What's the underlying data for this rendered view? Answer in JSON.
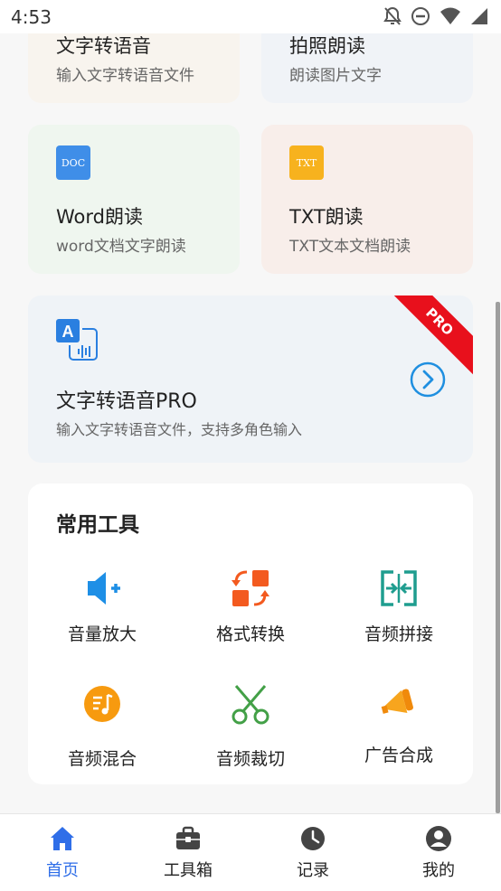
{
  "status_bar": {
    "time": "4:53"
  },
  "cards": {
    "text_to_speech": {
      "title": "文字转语音",
      "subtitle": "输入文字转语音文件"
    },
    "photo_read": {
      "title": "拍照朗读",
      "subtitle": "朗读图片文字"
    },
    "word_read": {
      "badge": "DOC",
      "title": "Word朗读",
      "subtitle": "word文档文字朗读"
    },
    "txt_read": {
      "badge": "TXT",
      "title": "TXT朗读",
      "subtitle": "TXT文本文档朗读"
    },
    "tts_pro": {
      "ribbon": "PRO",
      "title": "文字转语音PRO",
      "subtitle": "输入文字转语音文件，支持多角色输入"
    }
  },
  "tools": {
    "title": "常用工具",
    "items": [
      {
        "label": "音量放大",
        "icon": "volume-up-icon"
      },
      {
        "label": "格式转换",
        "icon": "format-convert-icon"
      },
      {
        "label": "音频拼接",
        "icon": "audio-join-icon"
      },
      {
        "label": "音频混合",
        "icon": "audio-mix-icon"
      },
      {
        "label": "音频裁切",
        "icon": "scissors-icon"
      },
      {
        "label": "广告合成",
        "icon": "megaphone-icon"
      }
    ]
  },
  "nav": {
    "items": [
      {
        "label": "首页",
        "icon": "home-icon",
        "active": true
      },
      {
        "label": "工具箱",
        "icon": "toolbox-icon"
      },
      {
        "label": "记录",
        "icon": "clock-icon"
      },
      {
        "label": "我的",
        "icon": "profile-icon"
      }
    ]
  },
  "colors": {
    "accent_blue": "#2f6ee8",
    "tool_blue": "#1e8fe6",
    "tool_orange": "#f35a1f",
    "tool_teal": "#1f9d8f",
    "tool_green": "#43a047",
    "ribbon_red": "#e8101c"
  }
}
